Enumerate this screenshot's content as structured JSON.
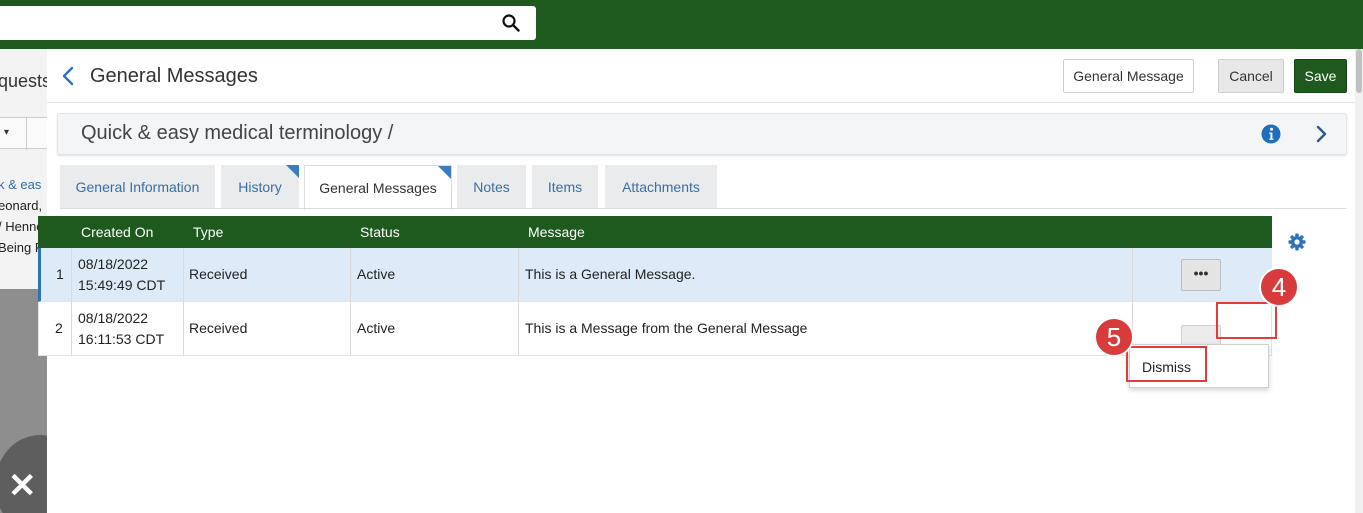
{
  "topbar": {
    "search": {
      "placeholder": "",
      "icon": "search-icon"
    }
  },
  "background_page": {
    "title_fragment": "quests",
    "caret": "▾",
    "lines": [
      "k & eas",
      "eonard,",
      "/ Henne",
      "Being Pr"
    ]
  },
  "panel": {
    "title": "General Messages",
    "buttons": {
      "general_message": "General Message",
      "cancel": "Cancel",
      "save": "Save"
    },
    "record": {
      "title": "Quick & easy medical terminology /"
    },
    "tabs": [
      {
        "label": "General Information",
        "active": false,
        "flag": false
      },
      {
        "label": "History",
        "active": false,
        "flag": true
      },
      {
        "label": "General Messages",
        "active": true,
        "flag": true
      },
      {
        "label": "Notes",
        "active": false,
        "flag": false
      },
      {
        "label": "Items",
        "active": false,
        "flag": false
      },
      {
        "label": "Attachments",
        "active": false,
        "flag": false
      }
    ]
  },
  "table": {
    "columns": [
      "Created On",
      "Type",
      "Status",
      "Message"
    ],
    "rows": [
      {
        "index": "1",
        "date": "08/18/2022",
        "time": "15:49:49 CDT",
        "type": "Received",
        "status": "Active",
        "message": "This is a General Message."
      },
      {
        "index": "2",
        "date": "08/18/2022",
        "time": "16:11:53 CDT",
        "type": "Received",
        "status": "Active",
        "message": "This is a Message from the General Message"
      }
    ],
    "row_actions_label": "•••"
  },
  "dropdown": {
    "items": [
      "Dismiss"
    ]
  },
  "callouts": {
    "step_4": "4",
    "step_5": "5"
  },
  "close_button": "✕",
  "colors": {
    "brand_green": "#1e5a1e",
    "link_blue": "#3a6ea5",
    "selected_row": "#dcebf7",
    "callout_red": "#d83b3b"
  }
}
